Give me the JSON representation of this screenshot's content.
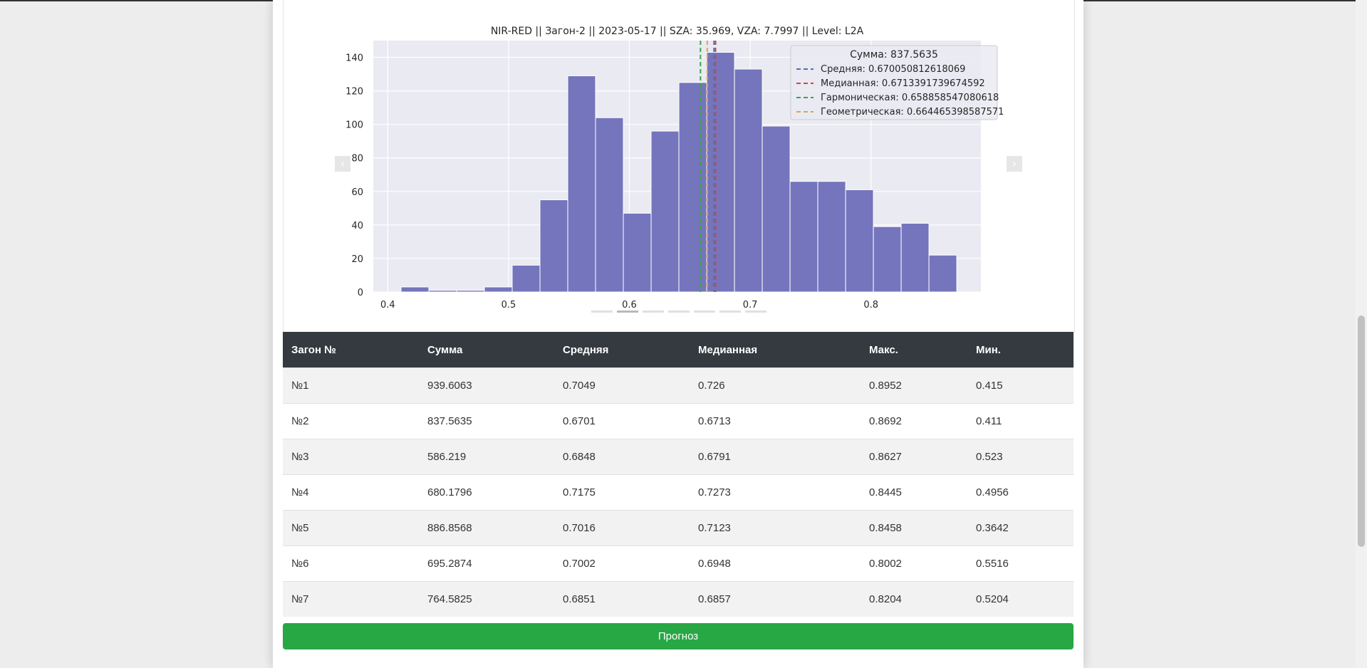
{
  "chart_data": {
    "type": "bar",
    "title": "NIR-RED || Загон-2 || 2023-05-17 || SZA: 35.969, VZA: 7.7997 || Level: L2A",
    "bin_edges": [
      0.411,
      0.434,
      0.457,
      0.48,
      0.503,
      0.526,
      0.549,
      0.572,
      0.595,
      0.618,
      0.641,
      0.664,
      0.687,
      0.71,
      0.733,
      0.756,
      0.779,
      0.802,
      0.825,
      0.848,
      0.871
    ],
    "values": [
      3,
      1,
      1,
      3,
      16,
      55,
      129,
      104,
      47,
      96,
      125,
      143,
      133,
      99,
      66,
      66,
      61,
      39,
      41,
      22
    ],
    "xlim": [
      0.388,
      0.891
    ],
    "ylim": [
      0,
      150
    ],
    "x_ticks": [
      0.4,
      0.5,
      0.6,
      0.7,
      0.8
    ],
    "x_tick_labels": [
      "0.4",
      "0.5",
      "0.6",
      "0.7",
      "0.8"
    ],
    "y_ticks": [
      0,
      20,
      40,
      60,
      80,
      100,
      120,
      140
    ],
    "y_tick_labels": [
      "0",
      "20",
      "40",
      "60",
      "80",
      "100",
      "120",
      "140"
    ],
    "bar_color": "#7575bd",
    "plot_bg": "#eaeaf2",
    "grid": true,
    "legend_position": "top-right",
    "legend": {
      "title": "Сумма: 837.5635",
      "entries": [
        {
          "label": "Средняя: 0.670050812618069",
          "color": "#4c72b0",
          "value": 0.670050812618069
        },
        {
          "label": "Медианная: 0.6713391739674592",
          "color": "#dd4040",
          "value": 0.6713391739674592
        },
        {
          "label": "Гармоническая: 0.658858547080618",
          "color": "#3aa34a",
          "value": 0.658858547080618
        },
        {
          "label": "Геометрическая: 0.664465398587571",
          "color": "#d9a650",
          "value": 0.664465398587571
        }
      ]
    }
  },
  "carousel": {
    "prev_icon": "chevron-left-icon",
    "next_icon": "chevron-right-icon",
    "prev_glyph": "‹",
    "next_glyph": "›",
    "slide_count": 7,
    "active_index": 1
  },
  "table": {
    "headers": [
      "Загон №",
      "Сумма",
      "Средняя",
      "Медианная",
      "Макс.",
      "Мин."
    ],
    "rows": [
      [
        "№1",
        "939.6063",
        "0.7049",
        "0.726",
        "0.8952",
        "0.415"
      ],
      [
        "№2",
        "837.5635",
        "0.6701",
        "0.6713",
        "0.8692",
        "0.411"
      ],
      [
        "№3",
        "586.219",
        "0.6848",
        "0.6791",
        "0.8627",
        "0.523"
      ],
      [
        "№4",
        "680.1796",
        "0.7175",
        "0.7273",
        "0.8445",
        "0.4956"
      ],
      [
        "№5",
        "886.8568",
        "0.7016",
        "0.7123",
        "0.8458",
        "0.3642"
      ],
      [
        "№6",
        "695.2874",
        "0.7002",
        "0.6948",
        "0.8002",
        "0.5516"
      ],
      [
        "№7",
        "764.5825",
        "0.6851",
        "0.6857",
        "0.8204",
        "0.5204"
      ]
    ]
  },
  "forecast_button": {
    "label": "Прогноз",
    "color": "#28a745"
  }
}
